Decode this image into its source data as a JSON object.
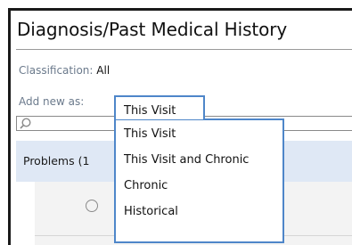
{
  "section": {
    "title": "Diagnosis/Past Medical History"
  },
  "classification": {
    "label": "Classification:",
    "value": "All"
  },
  "add_new": {
    "label": "Add new as:",
    "selected": "This Visit",
    "options": [
      "This Visit",
      "This Visit and Chronic",
      "Chronic",
      "Historical"
    ]
  },
  "search": {
    "icon": "search-icon",
    "value": ""
  },
  "problems": {
    "label": "Problems (1"
  },
  "colors": {
    "accent": "#4e86c9",
    "header_band": "#dfe8f5",
    "label_text": "#6b7a8c"
  }
}
